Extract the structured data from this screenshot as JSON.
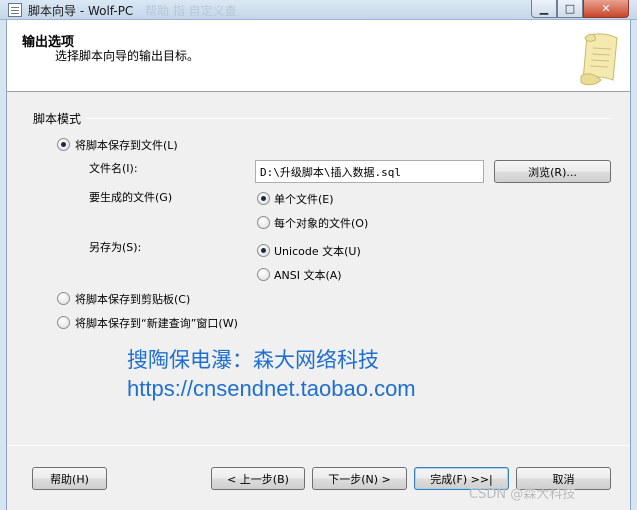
{
  "window": {
    "title": "脚本向导 - Wolf-PC",
    "bg_text": "帮助      指    自定义查",
    "min_glyph": "▁",
    "max_glyph": "□",
    "close_glyph": "✕"
  },
  "header": {
    "title": "输出选项",
    "subtitle": "选择脚本向导的输出目标。"
  },
  "group": {
    "label": "脚本模式"
  },
  "options": {
    "save_to_file": {
      "label": "将脚本保存到文件(L)",
      "checked": true
    },
    "file_name_label": "文件名(I):",
    "file_name_value": "D:\\升级脚本\\插入数据.sql",
    "browse_label": "浏览(R)...",
    "files_to_generate_label": "要生成的文件(G)",
    "single_file": {
      "label": "单个文件(E)",
      "checked": true
    },
    "file_per_object": {
      "label": "每个对象的文件(O)",
      "checked": false
    },
    "save_as_label": "另存为(S):",
    "unicode_text": {
      "label": "Unicode 文本(U)",
      "checked": true
    },
    "ansi_text": {
      "label": "ANSI 文本(A)",
      "checked": false
    },
    "save_to_clipboard": {
      "label": "将脚本保存到剪贴板(C)",
      "checked": false
    },
    "save_to_query_window": {
      "label": "将脚本保存到“新建查询”窗口(W)",
      "checked": false
    }
  },
  "watermark": {
    "line1": "搜陶保电瀑：森大网络科技",
    "line2": "https://cnsendnet.taobao.com",
    "color": "#1f6fd1"
  },
  "footer": {
    "help": "帮助(H)",
    "back": "< 上一步(B)",
    "next": "下一步(N) >",
    "finish": "完成(F) >>|",
    "cancel": "取消"
  },
  "csdn_watermark": "CSDN @森大科技",
  "colors": {
    "accent": "#1f6fd1",
    "close": "#c9452a",
    "frame": "#d7e4f2"
  }
}
